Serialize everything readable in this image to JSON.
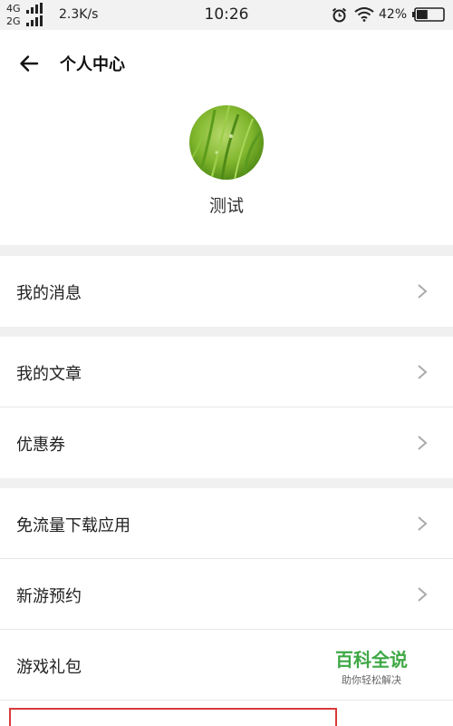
{
  "status_bar": {
    "net_line1": "4G",
    "net_line2": "2G",
    "speed": "2.3K/s",
    "time": "10:26",
    "battery_percent": "42%",
    "battery_level": 0.42
  },
  "header": {
    "title": "个人中心",
    "back_icon": "arrow-left-icon"
  },
  "profile": {
    "username": "测试",
    "avatar": "grass-photo"
  },
  "menu": {
    "my_messages": "我的消息",
    "my_articles": "我的文章",
    "coupons": "优惠券",
    "free_download_apps": "免流量下载应用",
    "new_game_reservation": "新游预约",
    "game_gift_pack": "游戏礼包"
  },
  "watermark": {
    "title": "百科全说",
    "subtitle": "助你轻松解决"
  },
  "colors": {
    "accent_green": "#3fa845",
    "highlight_red": "#d93a3a",
    "section_gap": "#f0f0f0"
  }
}
